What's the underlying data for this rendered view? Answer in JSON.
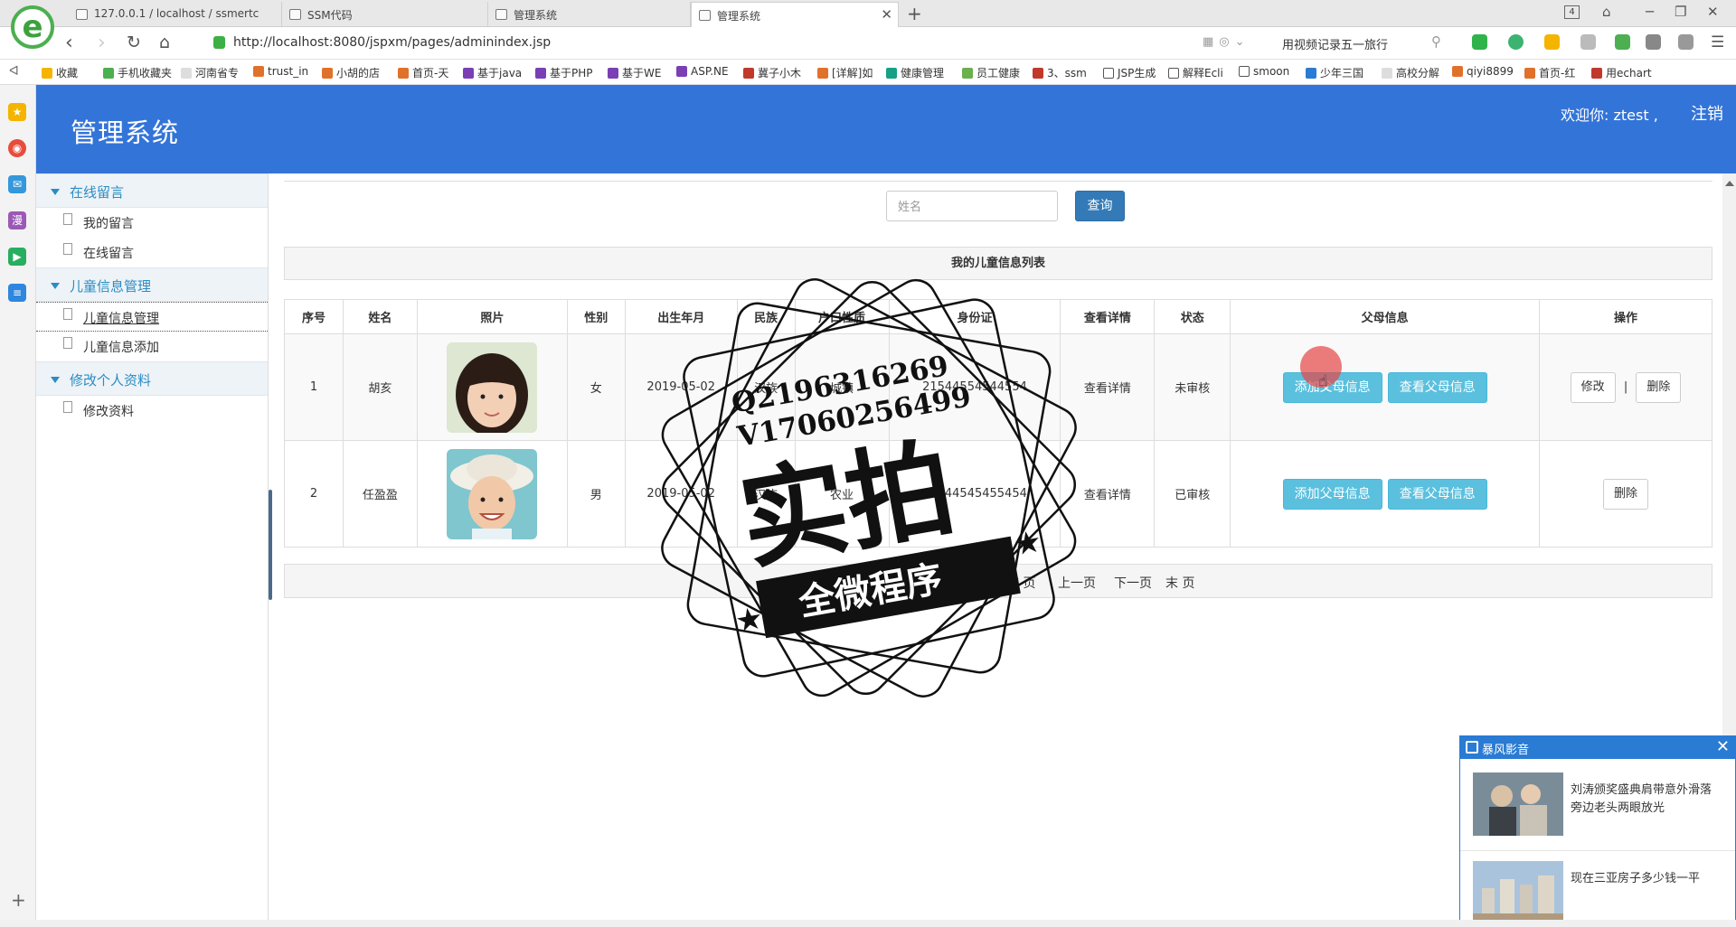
{
  "browser": {
    "tabs": [
      {
        "label": "127.0.0.1 / localhost / ssmertc"
      },
      {
        "label": "SSM代码"
      },
      {
        "label": "管理系统"
      },
      {
        "label": "管理系统",
        "active": true
      }
    ],
    "tab_count": "4",
    "url": "http://localhost:8080/jspxm/pages/adminindex.jsp",
    "search_text": "用视频记录五一旅行",
    "bookmarks": [
      "收藏",
      "手机收藏夹",
      "河南省专",
      "trust_in",
      "小胡的店",
      "首页-天",
      "基于java",
      "基于PHP",
      "基于WE",
      "ASP.NE",
      "冀子小木",
      "[详解]如",
      "健康管理",
      "员工健康",
      "3、ssm",
      "JSP生成",
      "解释Ecli",
      "smoon",
      "少年三国",
      "高校分解",
      "qiyi8899",
      "首页-红",
      "用echart"
    ]
  },
  "header": {
    "title": "管理系统",
    "welcome": "欢迎你: ztest ,",
    "logout": "注销"
  },
  "sidebar": {
    "groups": [
      {
        "label": "在线留言",
        "items": [
          {
            "label": "我的留言"
          },
          {
            "label": "在线留言"
          }
        ]
      },
      {
        "label": "儿童信息管理",
        "items": [
          {
            "label": "儿童信息管理",
            "selected": true
          },
          {
            "label": "儿童信息添加"
          }
        ]
      },
      {
        "label": "修改个人资料",
        "items": [
          {
            "label": "修改资料"
          }
        ]
      }
    ]
  },
  "search": {
    "placeholder": "姓名",
    "button": "查询"
  },
  "table": {
    "caption": "我的儿童信息列表",
    "columns": [
      "序号",
      "姓名",
      "照片",
      "性别",
      "出生年月",
      "民族",
      "户口性质",
      "身份证",
      "查看详情",
      "状态",
      "父母信息",
      "操作"
    ],
    "rows": [
      {
        "no": "1",
        "name": "胡亥",
        "gender": "女",
        "birth": "2019-05-02",
        "ethnic": "汉族",
        "hukou": "城镇",
        "id_card": "21544554544554",
        "detail": "查看详情",
        "status": "未审核",
        "parent_add": "添加父母信息",
        "parent_view": "查看父母信息",
        "edit": "修改",
        "sep": "|",
        "delete": "删除"
      },
      {
        "no": "2",
        "name": "任盈盈",
        "gender": "男",
        "birth": "2019-05-02",
        "ethnic": "汉族",
        "hukou": "农业",
        "id_card": "41544545455454",
        "detail": "查看详情",
        "status": "已审核",
        "parent_add": "添加父母信息",
        "parent_view": "查看父母信息",
        "delete": "删除"
      }
    ]
  },
  "pager": {
    "summary": "共2条记录",
    "first": "首 页",
    "prev": "上一页",
    "next": "下一页",
    "last": "末 页"
  },
  "watermark": {
    "contact_q": "Q2196316269",
    "contact_v": "V17060256499",
    "main_text": "实拍",
    "banner": "全微程序"
  },
  "popup": {
    "title": "暴风影音",
    "news": [
      {
        "title": "刘涛颁奖盛典肩带意外滑落 旁边老头两眼放光"
      },
      {
        "title": "现在三亚房子多少钱一平"
      }
    ]
  },
  "colors": {
    "header_bg": "#3374d8",
    "primary_btn": "#337ab7",
    "info_btn": "#5bc0de",
    "sidebar_accent": "#2a8cc4"
  }
}
